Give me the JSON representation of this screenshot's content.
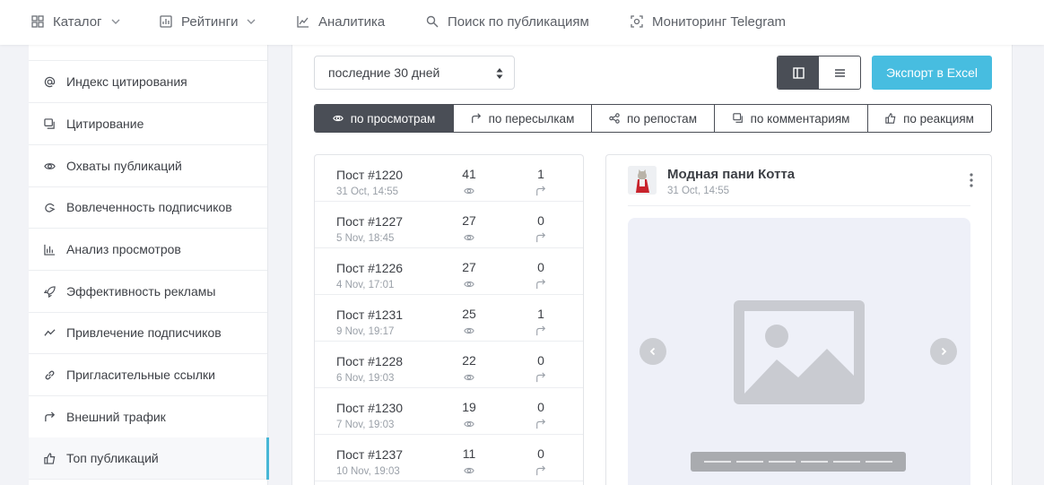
{
  "nav": {
    "items": [
      {
        "label": "Каталог",
        "icon": "grid-icon",
        "dropdown": true
      },
      {
        "label": "Рейтинги",
        "icon": "rating-icon",
        "dropdown": true
      },
      {
        "label": "Аналитика",
        "icon": "chart-line-icon",
        "dropdown": false
      },
      {
        "label": "Поиск по публикациям",
        "icon": "search-icon",
        "dropdown": false
      },
      {
        "label": "Мониторинг Telegram",
        "icon": "monitor-icon",
        "dropdown": false
      }
    ]
  },
  "sidebar": {
    "items": [
      {
        "label": "Индекс цитирования",
        "icon": "at-icon",
        "active": false
      },
      {
        "label": "Цитирование",
        "icon": "quote-icon",
        "active": false
      },
      {
        "label": "Охваты публикаций",
        "icon": "eye-icon",
        "active": false
      },
      {
        "label": "Вовлеченность подписчиков",
        "icon": "engagement-icon",
        "active": false
      },
      {
        "label": "Анализ просмотров",
        "icon": "bar-chart-icon",
        "active": false
      },
      {
        "label": "Эффективность рекламы",
        "icon": "rocket-icon",
        "active": false
      },
      {
        "label": "Привлечение подписчиков",
        "icon": "trend-icon",
        "active": false
      },
      {
        "label": "Пригласительные ссылки",
        "icon": "link-icon",
        "active": false
      },
      {
        "label": "Внешний трафик",
        "icon": "share-arrow-icon",
        "active": false
      },
      {
        "label": "Топ публикаций",
        "icon": "thumbs-up-icon",
        "active": true
      }
    ]
  },
  "toolbar": {
    "period_value": "последние 30 дней",
    "export_label": "Экспорт в Excel",
    "view_mode": "cards"
  },
  "sort_tabs": [
    {
      "label": "по просмотрам",
      "icon": "eye-icon",
      "active": true
    },
    {
      "label": "по пересылкам",
      "icon": "forward-icon",
      "active": false
    },
    {
      "label": "по репостам",
      "icon": "share-icon",
      "active": false
    },
    {
      "label": "по комментариям",
      "icon": "comment-icon",
      "active": false
    },
    {
      "label": "по реакциям",
      "icon": "thumbs-up-icon",
      "active": false
    }
  ],
  "posts": [
    {
      "title": "Пост #1220",
      "date": "31 Oct, 14:55",
      "views": "41",
      "forwards": "1"
    },
    {
      "title": "Пост #1227",
      "date": "5 Nov, 18:45",
      "views": "27",
      "forwards": "0"
    },
    {
      "title": "Пост #1226",
      "date": "4 Nov, 17:01",
      "views": "27",
      "forwards": "0"
    },
    {
      "title": "Пост #1231",
      "date": "9 Nov, 19:17",
      "views": "25",
      "forwards": "1"
    },
    {
      "title": "Пост #1228",
      "date": "6 Nov, 19:03",
      "views": "22",
      "forwards": "0"
    },
    {
      "title": "Пост #1230",
      "date": "7 Nov, 19:03",
      "views": "19",
      "forwards": "0"
    },
    {
      "title": "Пост #1237",
      "date": "10 Nov, 19:03",
      "views": "11",
      "forwards": "0"
    }
  ],
  "preview": {
    "channel_name": "Модная пани Котта",
    "date": "31 Oct, 14:55",
    "slide_count": 6
  },
  "colors": {
    "accent": "#47bde0",
    "active_marker": "#47b7d6",
    "dark": "#4a4e56"
  }
}
